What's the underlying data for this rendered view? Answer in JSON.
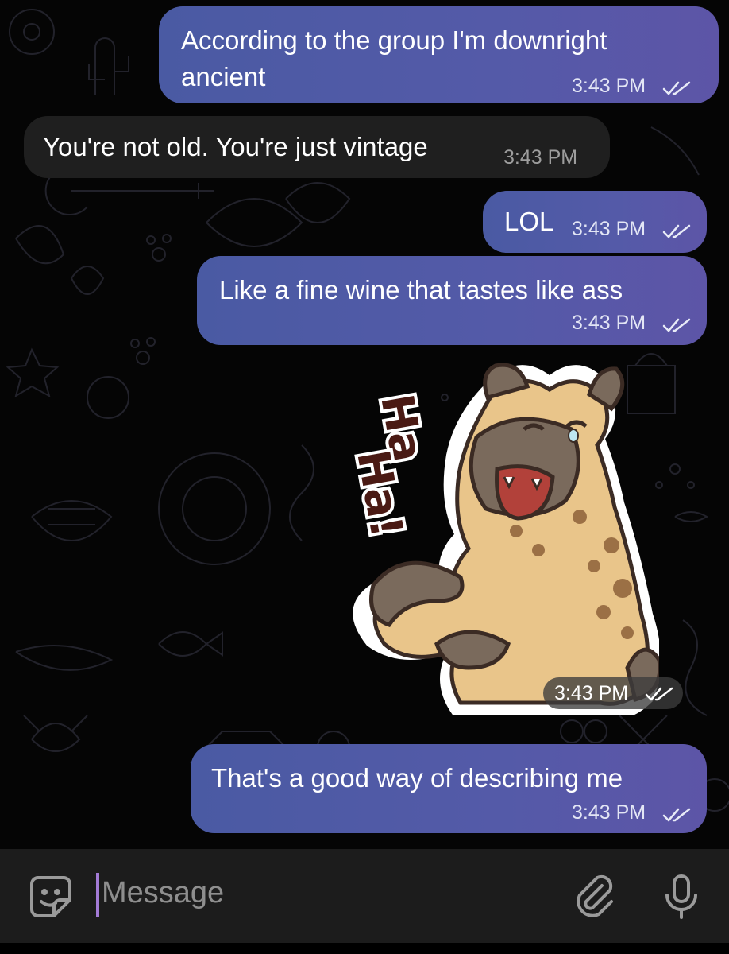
{
  "messages": [
    {
      "direction": "outgoing",
      "lines": [
        "According to the group I'm downright",
        "ancient"
      ],
      "time": "3:43 PM",
      "status": "read"
    },
    {
      "direction": "incoming",
      "lines": [
        "You're not old. You're just vintage"
      ],
      "time": "3:43 PM"
    },
    {
      "direction": "outgoing",
      "lines": [
        "LOL"
      ],
      "time": "3:43 PM",
      "status": "read"
    },
    {
      "direction": "outgoing",
      "lines": [
        "Like a fine wine that tastes like ass"
      ],
      "time": "3:43 PM",
      "status": "read"
    },
    {
      "direction": "outgoing",
      "type": "sticker",
      "sticker_text": [
        "Ha",
        "Ha!"
      ],
      "time": "3:43 PM",
      "status": "read"
    },
    {
      "direction": "outgoing",
      "lines": [
        "That's a good way of describing me"
      ],
      "time": "3:43 PM",
      "status": "read"
    }
  ],
  "composer": {
    "placeholder": "Message"
  },
  "icons": {
    "sticker": "sticker-icon",
    "attach": "paperclip-icon",
    "mic": "microphone-icon",
    "read": "double-check-icon"
  },
  "colors": {
    "outgoing_bubble": "#5258a6",
    "incoming_bubble": "#1f1f1f",
    "background": "#050505",
    "composer": "#1c1c1c",
    "caret": "#a37bd6"
  }
}
